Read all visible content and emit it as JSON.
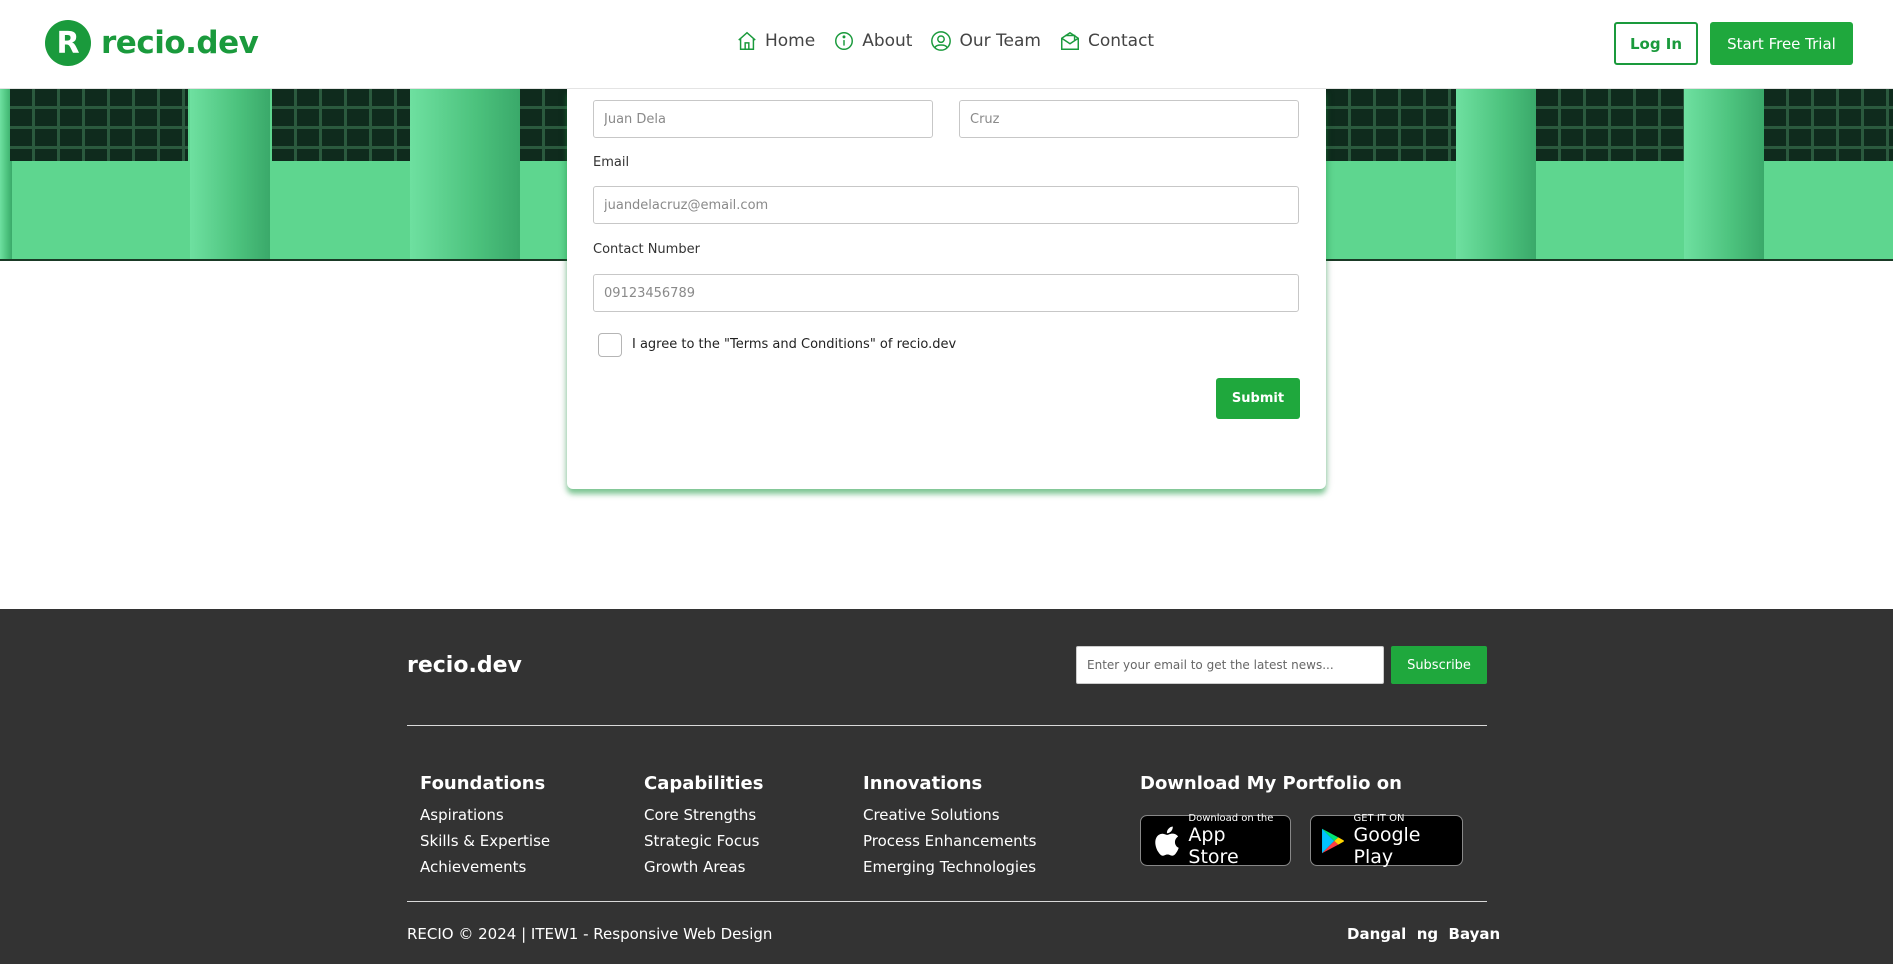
{
  "brand": {
    "logo_letter": "R",
    "name": "recio.dev"
  },
  "nav": {
    "items": [
      {
        "label": "Home",
        "icon": "home-icon"
      },
      {
        "label": "About",
        "icon": "info-icon"
      },
      {
        "label": "Our Team",
        "icon": "user-circle-icon"
      },
      {
        "label": "Contact",
        "icon": "envelope-icon"
      }
    ],
    "login_label": "Log In",
    "trial_label": "Start Free Trial"
  },
  "form": {
    "first_name_placeholder": "Juan Dela",
    "last_name_placeholder": "Cruz",
    "email_label": "Email",
    "email_placeholder": "juandelacruz@email.com",
    "contact_label": "Contact Number",
    "contact_placeholder": "09123456789",
    "terms_label": "I agree to the \"Terms and Conditions\" of recio.dev",
    "submit_label": "Submit"
  },
  "footer": {
    "brand": "recio.dev",
    "newsletter_placeholder": "Enter your email to get the latest news...",
    "subscribe_label": "Subscribe",
    "columns": [
      {
        "title": "Foundations",
        "links": [
          "Aspirations",
          "Skills & Expertise",
          "Achievements"
        ]
      },
      {
        "title": "Capabilities",
        "links": [
          "Core Strengths",
          "Strategic Focus",
          "Growth Areas"
        ]
      },
      {
        "title": "Innovations",
        "links": [
          "Creative Solutions",
          "Process Enhancements",
          "Emerging Technologies"
        ]
      }
    ],
    "download_title": "Download My Portfolio on",
    "app_store": {
      "small": "Download on the",
      "big": "App Store"
    },
    "google_play": {
      "small": "GET IT ON",
      "big": "Google Play"
    },
    "copyright": "RECIO © 2024 | ITEW1 - Responsive Web Design",
    "motto": "Dangal  ng  Bayan"
  },
  "colors": {
    "brand_green": "#1a9a3c",
    "button_green": "#1fa83d",
    "hero_green": "#5ed68f",
    "footer_bg": "#333333"
  }
}
